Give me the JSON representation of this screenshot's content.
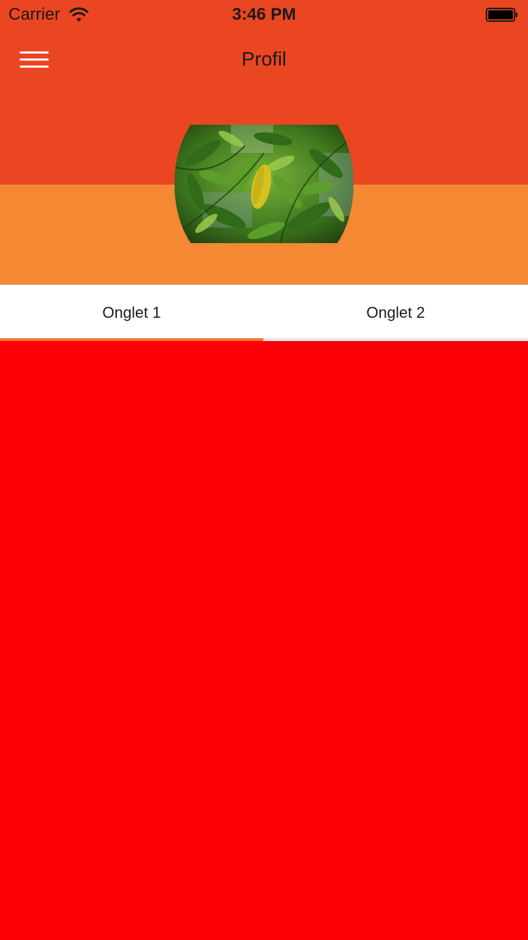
{
  "status_bar": {
    "carrier": "Carrier",
    "time": "3:46 PM",
    "wifi_icon": "wifi-icon",
    "battery_icon": "battery-icon"
  },
  "nav_bar": {
    "menu_icon": "hamburger-menu-icon",
    "title": "Profil"
  },
  "profile": {
    "avatar_description_icon": "leaf-photo"
  },
  "tabs": [
    {
      "label": "Onglet 1",
      "selected": true
    },
    {
      "label": "Onglet 2",
      "selected": false
    }
  ],
  "colors": {
    "header": "#ea4622",
    "profile_band": "#f48833",
    "tab_indicator_active": "#f47532",
    "tab_indicator_inactive": "#e6e6e6",
    "content_background": "#fc0207"
  }
}
